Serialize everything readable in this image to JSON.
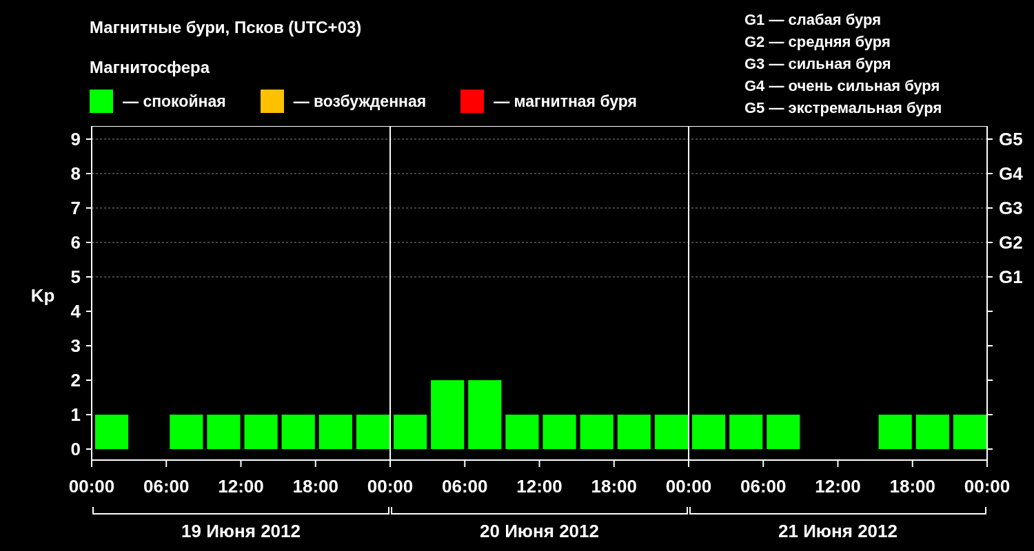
{
  "title": "Магнитные бури, Псков (UTC+03)",
  "legend": {
    "title": "Магнитосфера",
    "items": [
      {
        "label": "— спокойная",
        "color": "#00ff00"
      },
      {
        "label": "— возбужденная",
        "color": "#ffc000"
      },
      {
        "label": "— магнитная буря",
        "color": "#ff0000"
      }
    ]
  },
  "storm_scale": [
    "G1 — слабая буря",
    "G2 — средняя буря",
    "G3 — сильная буря",
    "G4 — очень сильная буря",
    "G5 — экстремальная буря"
  ],
  "chart": {
    "days": [
      "19 Июня 2012",
      "20 Июня 2012",
      "21 Июня 2012"
    ],
    "time_labels": [
      "00:00",
      "06:00",
      "12:00",
      "18:00",
      "00:00",
      "06:00",
      "12:00",
      "18:00",
      "00:00"
    ],
    "right_ticks": [
      "G5",
      "G4",
      "G3",
      "G2",
      "G1"
    ],
    "chart_data": {
      "type": "bar",
      "ylabel": "Kp",
      "x": [
        1.5,
        4.5,
        7.5,
        10.5,
        13.5,
        16.5,
        19.5,
        22.5,
        25.5,
        28.5,
        31.5,
        34.5,
        37.5,
        40.5,
        43.5,
        46.5,
        49.5,
        52.5,
        55.5,
        58.5,
        61.5,
        64.5,
        67.5,
        70.5
      ],
      "grid": true,
      "ref_lines": [
        {
          "axis": "x",
          "value": 24
        },
        {
          "axis": "x",
          "value": 48
        }
      ],
      "series": [
        {
          "color": "#00ff00",
          "values": [
            1,
            0,
            1,
            1,
            1,
            1,
            1,
            1,
            1,
            2,
            2,
            1,
            1,
            1,
            1,
            1,
            1,
            1,
            1,
            0,
            0,
            1,
            1,
            1
          ]
        }
      ],
      "xlim": [
        0,
        72
      ],
      "ylim": [
        -0.32,
        9.38
      ],
      "xticks": [
        {
          "value": 0,
          "label": "00:00"
        },
        {
          "value": 6,
          "label": "06:00"
        },
        {
          "value": 12,
          "label": "12:00"
        },
        {
          "value": 18,
          "label": "18:00"
        }
      ],
      "yticks": [
        0,
        1,
        2,
        3,
        4,
        5,
        6,
        7,
        8,
        9
      ]
    }
  }
}
